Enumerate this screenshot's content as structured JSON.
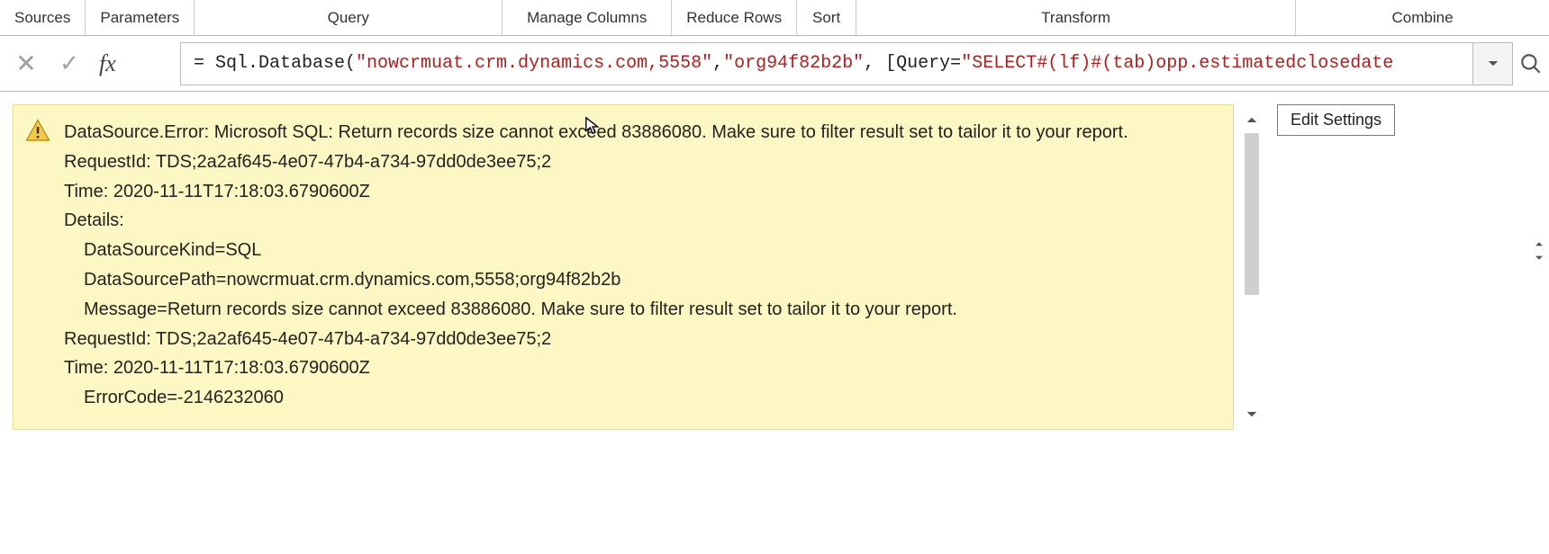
{
  "ribbon": {
    "sources": "Sources",
    "parameters": "Parameters",
    "query": "Query",
    "manage_columns": "Manage Columns",
    "reduce_rows": "Reduce Rows",
    "sort": "Sort",
    "transform": "Transform",
    "combine": "Combine"
  },
  "formula": {
    "cancel_glyph": "✕",
    "accept_glyph": "✓",
    "fx_label": "fx",
    "prefix": "= Sql.Database(",
    "arg1": "\"nowcrmuat.crm.dynamics.com,5558\"",
    "sep1": ", ",
    "arg2": "\"org94f82b2b\"",
    "sep2": ", [Query=",
    "arg3": "\"SELECT#(lf)#(tab)opp.estimatedclosedate"
  },
  "error": {
    "line1": "DataSource.Error: Microsoft SQL: Return records size cannot exceed 83886080. Make sure to filter result set to tailor it to your report.",
    "request_id": "RequestId: TDS;2a2af645-4e07-47b4-a734-97dd0de3ee75;2",
    "time": "Time: 2020-11-11T17:18:03.6790600Z",
    "details_label": "Details:",
    "ds_kind": "DataSourceKind=SQL",
    "ds_path": "DataSourcePath=nowcrmuat.crm.dynamics.com,5558;org94f82b2b",
    "message": "Message=Return records size cannot exceed 83886080. Make sure to filter result set to tailor it to your report.",
    "request_id2": "RequestId: TDS;2a2af645-4e07-47b4-a734-97dd0de3ee75;2",
    "time2": "Time: 2020-11-11T17:18:03.6790600Z",
    "error_code": "ErrorCode=-2146232060"
  },
  "buttons": {
    "edit_settings": "Edit Settings"
  }
}
